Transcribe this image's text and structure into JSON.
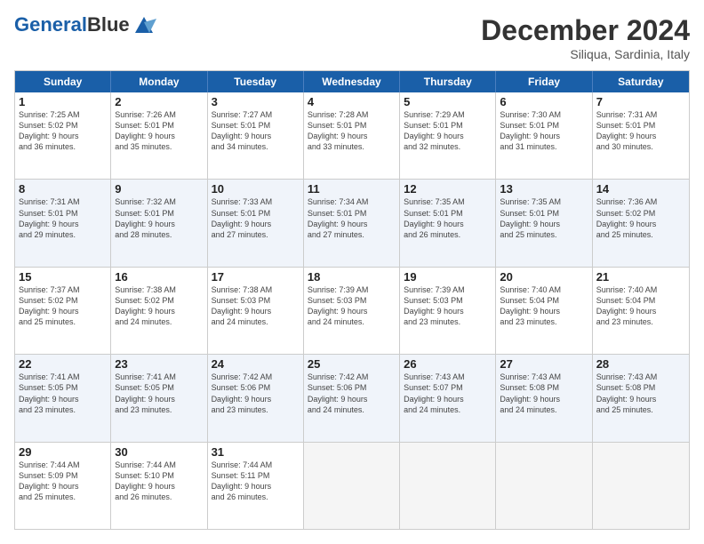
{
  "header": {
    "logo_line1": "General",
    "logo_line2": "Blue",
    "month": "December 2024",
    "location": "Siliqua, Sardinia, Italy"
  },
  "day_names": [
    "Sunday",
    "Monday",
    "Tuesday",
    "Wednesday",
    "Thursday",
    "Friday",
    "Saturday"
  ],
  "rows": [
    {
      "alt": false,
      "cells": [
        {
          "date": "1",
          "info": "Sunrise: 7:25 AM\nSunset: 5:02 PM\nDaylight: 9 hours\nand 36 minutes."
        },
        {
          "date": "2",
          "info": "Sunrise: 7:26 AM\nSunset: 5:01 PM\nDaylight: 9 hours\nand 35 minutes."
        },
        {
          "date": "3",
          "info": "Sunrise: 7:27 AM\nSunset: 5:01 PM\nDaylight: 9 hours\nand 34 minutes."
        },
        {
          "date": "4",
          "info": "Sunrise: 7:28 AM\nSunset: 5:01 PM\nDaylight: 9 hours\nand 33 minutes."
        },
        {
          "date": "5",
          "info": "Sunrise: 7:29 AM\nSunset: 5:01 PM\nDaylight: 9 hours\nand 32 minutes."
        },
        {
          "date": "6",
          "info": "Sunrise: 7:30 AM\nSunset: 5:01 PM\nDaylight: 9 hours\nand 31 minutes."
        },
        {
          "date": "7",
          "info": "Sunrise: 7:31 AM\nSunset: 5:01 PM\nDaylight: 9 hours\nand 30 minutes."
        }
      ]
    },
    {
      "alt": true,
      "cells": [
        {
          "date": "8",
          "info": "Sunrise: 7:31 AM\nSunset: 5:01 PM\nDaylight: 9 hours\nand 29 minutes."
        },
        {
          "date": "9",
          "info": "Sunrise: 7:32 AM\nSunset: 5:01 PM\nDaylight: 9 hours\nand 28 minutes."
        },
        {
          "date": "10",
          "info": "Sunrise: 7:33 AM\nSunset: 5:01 PM\nDaylight: 9 hours\nand 27 minutes."
        },
        {
          "date": "11",
          "info": "Sunrise: 7:34 AM\nSunset: 5:01 PM\nDaylight: 9 hours\nand 27 minutes."
        },
        {
          "date": "12",
          "info": "Sunrise: 7:35 AM\nSunset: 5:01 PM\nDaylight: 9 hours\nand 26 minutes."
        },
        {
          "date": "13",
          "info": "Sunrise: 7:35 AM\nSunset: 5:01 PM\nDaylight: 9 hours\nand 25 minutes."
        },
        {
          "date": "14",
          "info": "Sunrise: 7:36 AM\nSunset: 5:02 PM\nDaylight: 9 hours\nand 25 minutes."
        }
      ]
    },
    {
      "alt": false,
      "cells": [
        {
          "date": "15",
          "info": "Sunrise: 7:37 AM\nSunset: 5:02 PM\nDaylight: 9 hours\nand 25 minutes."
        },
        {
          "date": "16",
          "info": "Sunrise: 7:38 AM\nSunset: 5:02 PM\nDaylight: 9 hours\nand 24 minutes."
        },
        {
          "date": "17",
          "info": "Sunrise: 7:38 AM\nSunset: 5:03 PM\nDaylight: 9 hours\nand 24 minutes."
        },
        {
          "date": "18",
          "info": "Sunrise: 7:39 AM\nSunset: 5:03 PM\nDaylight: 9 hours\nand 24 minutes."
        },
        {
          "date": "19",
          "info": "Sunrise: 7:39 AM\nSunset: 5:03 PM\nDaylight: 9 hours\nand 23 minutes."
        },
        {
          "date": "20",
          "info": "Sunrise: 7:40 AM\nSunset: 5:04 PM\nDaylight: 9 hours\nand 23 minutes."
        },
        {
          "date": "21",
          "info": "Sunrise: 7:40 AM\nSunset: 5:04 PM\nDaylight: 9 hours\nand 23 minutes."
        }
      ]
    },
    {
      "alt": true,
      "cells": [
        {
          "date": "22",
          "info": "Sunrise: 7:41 AM\nSunset: 5:05 PM\nDaylight: 9 hours\nand 23 minutes."
        },
        {
          "date": "23",
          "info": "Sunrise: 7:41 AM\nSunset: 5:05 PM\nDaylight: 9 hours\nand 23 minutes."
        },
        {
          "date": "24",
          "info": "Sunrise: 7:42 AM\nSunset: 5:06 PM\nDaylight: 9 hours\nand 23 minutes."
        },
        {
          "date": "25",
          "info": "Sunrise: 7:42 AM\nSunset: 5:06 PM\nDaylight: 9 hours\nand 24 minutes."
        },
        {
          "date": "26",
          "info": "Sunrise: 7:43 AM\nSunset: 5:07 PM\nDaylight: 9 hours\nand 24 minutes."
        },
        {
          "date": "27",
          "info": "Sunrise: 7:43 AM\nSunset: 5:08 PM\nDaylight: 9 hours\nand 24 minutes."
        },
        {
          "date": "28",
          "info": "Sunrise: 7:43 AM\nSunset: 5:08 PM\nDaylight: 9 hours\nand 25 minutes."
        }
      ]
    },
    {
      "alt": false,
      "cells": [
        {
          "date": "29",
          "info": "Sunrise: 7:44 AM\nSunset: 5:09 PM\nDaylight: 9 hours\nand 25 minutes."
        },
        {
          "date": "30",
          "info": "Sunrise: 7:44 AM\nSunset: 5:10 PM\nDaylight: 9 hours\nand 26 minutes."
        },
        {
          "date": "31",
          "info": "Sunrise: 7:44 AM\nSunset: 5:11 PM\nDaylight: 9 hours\nand 26 minutes."
        },
        {
          "date": "",
          "info": ""
        },
        {
          "date": "",
          "info": ""
        },
        {
          "date": "",
          "info": ""
        },
        {
          "date": "",
          "info": ""
        }
      ]
    }
  ]
}
